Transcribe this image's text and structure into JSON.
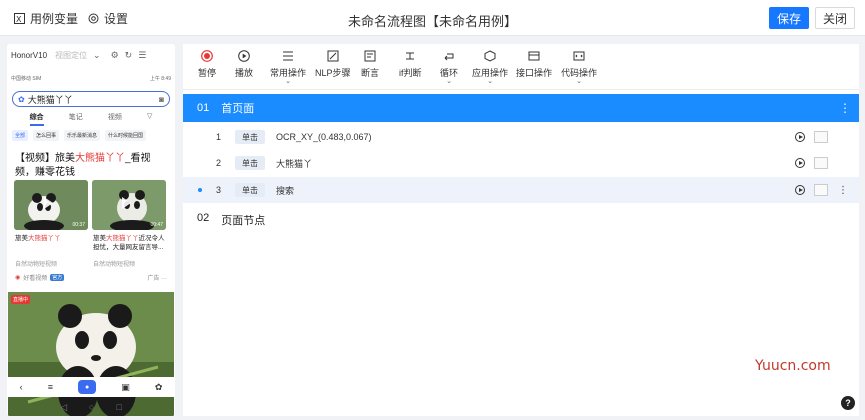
{
  "topbar": {
    "vars_label": "用例变量",
    "settings_label": "设置",
    "title": "未命名流程图【未命名用例】",
    "save_label": "保存",
    "close_label": "关闭"
  },
  "phone": {
    "device": "HonorV10",
    "position_label": "视图定位",
    "status_left": "中国移动 SIM",
    "status_right": "上午 8:49",
    "search_value": "大熊猫丫丫",
    "tabs": [
      "综合",
      "笔记",
      "视频",
      "▽"
    ],
    "chips": [
      "全部",
      "怎么回事",
      "乐乐最新消息",
      "什么时候能回国"
    ],
    "result_title_pre": "【视频】旅美",
    "result_title_hl": "大熊猫丫丫",
    "result_title_post": "_看视频，赚零花钱",
    "card1_duration": "00:37",
    "card2_duration": "00:47",
    "card1_caption_pre": "旅美",
    "card1_caption_hl": "大熊猫丫丫",
    "card2_caption_pre": "旅美",
    "card2_caption_hl": "大熊猫丫丫",
    "card2_caption_post": "近况令人担忧，大量网友留言导...",
    "card1_source": "自然动物短视频",
    "card2_source": "自然动物短视频",
    "meta_source": "好看视频",
    "meta_badge": "官方",
    "meta_ad": "广告 ···",
    "live_badge": "直播中"
  },
  "toolbar": [
    {
      "icon": "record-icon",
      "label": "暂停"
    },
    {
      "icon": "play-icon",
      "label": "播放"
    },
    {
      "icon": "list-icon",
      "label": "常用操作"
    },
    {
      "icon": "nlp-icon",
      "label": "NLP步骤"
    },
    {
      "icon": "assert-icon",
      "label": "断言"
    },
    {
      "icon": "branch-icon",
      "label": "if判断"
    },
    {
      "icon": "loop-icon",
      "label": "循环"
    },
    {
      "icon": "cube-icon",
      "label": "应用操作"
    },
    {
      "icon": "api-icon",
      "label": "接口操作"
    },
    {
      "icon": "code-icon",
      "label": "代码操作"
    }
  ],
  "page1": {
    "num": "01",
    "name": "首页面"
  },
  "steps": [
    {
      "idx": "1",
      "action": "单击",
      "desc": "OCR_XY_(0.483,0.067)"
    },
    {
      "idx": "2",
      "action": "单击",
      "desc": "大熊猫丫"
    },
    {
      "idx": "3",
      "action": "单击",
      "desc": "搜索"
    }
  ],
  "page2": {
    "num": "02",
    "name": "页面节点"
  },
  "watermark": "Yuucn.com",
  "help": "?"
}
